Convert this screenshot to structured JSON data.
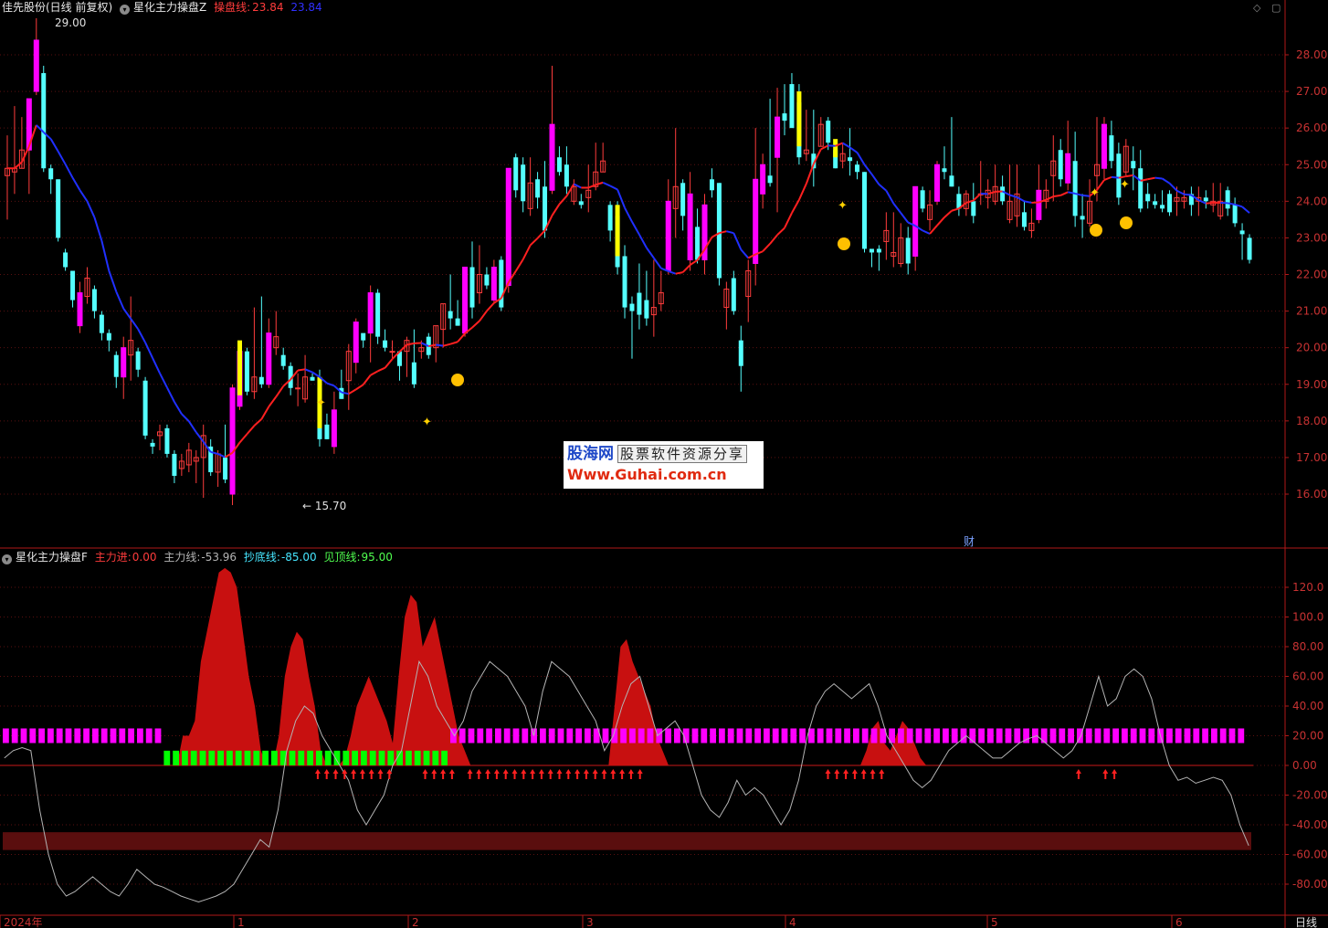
{
  "main_header": {
    "stock": "佳先股份(日线 前复权)",
    "indicator": "星化主力操盘Z",
    "line_label": "操盘线:",
    "line_value_1": "23.84",
    "line_value_2": "23.84"
  },
  "sub_header": {
    "indicator": "星化主力操盘F",
    "items": [
      {
        "label": "主力进:",
        "value": "0.00",
        "color": "#ff3c3c"
      },
      {
        "label": "主力线:",
        "value": "-53.96",
        "color": "#b4b4b4"
      },
      {
        "label": "抄底线:",
        "value": "-85.00",
        "color": "#46e6ff"
      },
      {
        "label": "见顶线:",
        "value": "95.00",
        "color": "#50ff50"
      }
    ]
  },
  "price_axis_labels": [
    "28.00",
    "27.00",
    "26.00",
    "25.00",
    "24.00",
    "23.00",
    "22.00",
    "21.00",
    "20.00",
    "19.00",
    "18.00",
    "17.00",
    "16.00"
  ],
  "osc_axis_labels": [
    "120.0",
    "100.0",
    "80.00",
    "60.00",
    "40.00",
    "20.00",
    "0.00",
    "-20.00",
    "-40.00",
    "-60.00",
    "-80.00"
  ],
  "date_labels": [
    "2024年",
    "1",
    "2",
    "3",
    "4",
    "5",
    "6"
  ],
  "period_label": "日线",
  "annotations": {
    "high": "29.00",
    "low": "15.70",
    "cai": "财"
  },
  "watermark": {
    "name": "股海网",
    "tag": "股票软件资源分享",
    "url": "Www.Guhai.com.cn"
  },
  "colors": {
    "up": "#ff3c3c",
    "down": "#54ffff",
    "up_fill": "#ff00ff",
    "highlight": "#ffff00",
    "line_up": "#ff2020",
    "line_down": "#2030ff",
    "area": "#c81010"
  },
  "chart_data": {
    "type": "candlestick",
    "price_range": [
      15.0,
      28.6
    ],
    "candles": [
      [
        24.7,
        24.9,
        23.5,
        25.8
      ],
      [
        24.8,
        24.9,
        24.2,
        26.6
      ],
      [
        24.9,
        25.4,
        24.9,
        26.3
      ],
      [
        25.4,
        26.8,
        24.2,
        26.8
      ],
      [
        27.0,
        28.4,
        26.9,
        29.0
      ],
      [
        27.5,
        24.9,
        24.8,
        27.7
      ],
      [
        24.9,
        24.6,
        24.2,
        25.0
      ],
      [
        24.6,
        23.0,
        22.9,
        24.6
      ],
      [
        22.6,
        22.2,
        22.1,
        22.7
      ],
      [
        22.1,
        21.3,
        21.1,
        22.1
      ],
      [
        20.6,
        21.5,
        20.4,
        21.8
      ],
      [
        21.4,
        21.9,
        21.2,
        22.2
      ],
      [
        21.6,
        21.0,
        20.8,
        21.7
      ],
      [
        20.9,
        20.4,
        20.2,
        21.0
      ],
      [
        20.4,
        20.2,
        19.9,
        20.5
      ],
      [
        19.8,
        19.2,
        18.9,
        19.9
      ],
      [
        19.2,
        20.0,
        18.6,
        20.3
      ],
      [
        19.8,
        20.2,
        19.1,
        21.4
      ],
      [
        19.9,
        19.4,
        19.2,
        20.0
      ],
      [
        19.1,
        17.6,
        17.5,
        19.2
      ],
      [
        17.4,
        17.3,
        17.1,
        17.5
      ],
      [
        17.6,
        17.7,
        17.2,
        17.9
      ],
      [
        17.8,
        17.1,
        17.0,
        17.9
      ],
      [
        17.1,
        16.5,
        16.3,
        17.2
      ],
      [
        16.7,
        16.9,
        16.5,
        17.1
      ],
      [
        16.8,
        17.2,
        16.6,
        17.4
      ],
      [
        16.9,
        17.0,
        16.3,
        17.2
      ],
      [
        17.0,
        17.6,
        15.9,
        17.9
      ],
      [
        17.3,
        16.6,
        16.5,
        17.5
      ],
      [
        16.6,
        17.1,
        16.2,
        17.2
      ],
      [
        17.0,
        16.4,
        16.3,
        17.9
      ],
      [
        16.0,
        18.9,
        15.7,
        19.0
      ],
      [
        18.4,
        19.9,
        18.3,
        20.0
      ],
      [
        19.9,
        18.8,
        18.7,
        20.0
      ],
      [
        18.8,
        19.2,
        18.6,
        21.1
      ],
      [
        19.2,
        19.0,
        18.9,
        21.4
      ],
      [
        19.0,
        20.4,
        18.9,
        20.8
      ],
      [
        20.0,
        20.3,
        19.8,
        21.0
      ],
      [
        19.8,
        19.5,
        19.4,
        20.0
      ],
      [
        19.5,
        18.9,
        18.7,
        19.6
      ],
      [
        18.9,
        18.9,
        18.4,
        19.3
      ],
      [
        18.6,
        19.2,
        18.5,
        19.8
      ],
      [
        19.2,
        19.1,
        19.1,
        19.3
      ],
      [
        18.9,
        17.5,
        17.3,
        19.4
      ],
      [
        17.9,
        17.5,
        17.5,
        18.2
      ],
      [
        17.3,
        18.3,
        17.1,
        18.8
      ],
      [
        18.9,
        18.6,
        18.6,
        19.4
      ],
      [
        19.1,
        19.9,
        18.3,
        20.1
      ],
      [
        19.6,
        20.7,
        19.3,
        20.8
      ],
      [
        20.4,
        20.2,
        20.0,
        20.3
      ],
      [
        20.4,
        21.5,
        19.6,
        21.7
      ],
      [
        21.5,
        20.3,
        20.1,
        21.6
      ],
      [
        20.2,
        20.0,
        19.9,
        20.5
      ],
      [
        19.9,
        19.9,
        19.7,
        20.2
      ],
      [
        19.9,
        19.5,
        19.1,
        19.9
      ],
      [
        19.9,
        20.2,
        19.2,
        20.3
      ],
      [
        19.6,
        19.0,
        18.9,
        20.5
      ],
      [
        19.9,
        20.0,
        19.7,
        20.2
      ],
      [
        20.3,
        19.8,
        19.7,
        20.4
      ],
      [
        20.0,
        20.6,
        19.6,
        20.6
      ],
      [
        20.5,
        21.2,
        20.0,
        21.2
      ],
      [
        21.0,
        20.8,
        20.5,
        22.0
      ],
      [
        20.8,
        20.6,
        20.6,
        21.3
      ],
      [
        20.4,
        22.2,
        20.3,
        22.2
      ],
      [
        22.2,
        21.1,
        20.8,
        22.9
      ],
      [
        21.5,
        22.0,
        21.2,
        22.8
      ],
      [
        22.0,
        21.7,
        21.6,
        22.2
      ],
      [
        21.3,
        22.2,
        21.2,
        22.4
      ],
      [
        22.4,
        21.1,
        21.0,
        22.5
      ],
      [
        21.7,
        24.9,
        21.5,
        24.9
      ],
      [
        25.2,
        24.3,
        24.1,
        25.3
      ],
      [
        25.0,
        24.0,
        23.7,
        25.2
      ],
      [
        23.8,
        24.5,
        23.6,
        25.2
      ],
      [
        24.6,
        24.1,
        23.8,
        24.8
      ],
      [
        24.4,
        23.2,
        23.0,
        25.1
      ],
      [
        24.3,
        26.1,
        24.2,
        27.7
      ],
      [
        25.2,
        24.8,
        24.7,
        25.5
      ],
      [
        25.0,
        24.4,
        24.2,
        25.5
      ],
      [
        24.0,
        24.4,
        23.9,
        24.6
      ],
      [
        24.0,
        23.9,
        23.8,
        24.2
      ],
      [
        24.1,
        24.3,
        23.7,
        25.0
      ],
      [
        24.4,
        24.8,
        24.3,
        25.6
      ],
      [
        24.8,
        25.1,
        24.8,
        25.6
      ],
      [
        23.9,
        23.2,
        22.9,
        24.0
      ],
      [
        23.6,
        22.2,
        22.0,
        24.0
      ],
      [
        22.5,
        21.1,
        20.8,
        22.8
      ],
      [
        21.2,
        21.0,
        19.7,
        21.4
      ],
      [
        21.5,
        20.9,
        20.5,
        22.3
      ],
      [
        21.3,
        20.8,
        20.6,
        22.1
      ],
      [
        20.9,
        21.1,
        20.3,
        22.4
      ],
      [
        21.2,
        21.5,
        21.0,
        22.1
      ],
      [
        22.1,
        24.0,
        22.0,
        24.6
      ],
      [
        23.8,
        24.4,
        23.0,
        26.0
      ],
      [
        24.5,
        23.6,
        23.2,
        24.6
      ],
      [
        22.4,
        24.2,
        22.1,
        24.8
      ],
      [
        23.3,
        22.4,
        22.3,
        23.8
      ],
      [
        22.4,
        23.9,
        22.0,
        24.2
      ],
      [
        24.6,
        24.3,
        24.1,
        24.9
      ],
      [
        24.5,
        21.9,
        21.7,
        24.5
      ],
      [
        21.1,
        21.6,
        20.5,
        21.8
      ],
      [
        21.9,
        21.0,
        20.9,
        22.1
      ],
      [
        20.2,
        19.5,
        18.8,
        20.6
      ],
      [
        21.4,
        22.1,
        20.7,
        22.4
      ],
      [
        22.3,
        24.6,
        21.7,
        26.0
      ],
      [
        24.2,
        25.0,
        23.8,
        25.3
      ],
      [
        24.7,
        24.5,
        24.4,
        26.8
      ],
      [
        25.2,
        26.3,
        23.7,
        27.1
      ],
      [
        26.4,
        26.2,
        25.8,
        27.2
      ],
      [
        27.2,
        26.0,
        26.1,
        27.5
      ],
      [
        26.7,
        25.2,
        25.0,
        27.2
      ],
      [
        25.3,
        25.4,
        25.1,
        26.5
      ],
      [
        25.3,
        24.9,
        24.4,
        26.5
      ],
      [
        25.5,
        26.1,
        25.5,
        26.3
      ],
      [
        26.2,
        25.6,
        25.4,
        26.3
      ],
      [
        25.4,
        24.9,
        24.9,
        25.4
      ],
      [
        25.1,
        25.3,
        24.9,
        25.6
      ],
      [
        25.2,
        25.1,
        24.7,
        26.0
      ],
      [
        25.0,
        24.8,
        24.6,
        25.1
      ],
      [
        24.8,
        22.7,
        22.6,
        24.8
      ],
      [
        22.7,
        22.6,
        22.2,
        22.6
      ],
      [
        22.7,
        22.6,
        22.1,
        22.8
      ],
      [
        22.9,
        23.2,
        22.4,
        23.7
      ],
      [
        22.5,
        22.6,
        22.2,
        23.7
      ],
      [
        22.3,
        23.0,
        22.2,
        23.4
      ],
      [
        23.0,
        22.3,
        22.0,
        23.3
      ],
      [
        22.5,
        24.4,
        22.1,
        24.4
      ],
      [
        24.3,
        23.8,
        23.7,
        24.4
      ],
      [
        23.5,
        23.9,
        23.2,
        24.3
      ],
      [
        24.0,
        25.0,
        23.9,
        25.1
      ],
      [
        24.9,
        24.8,
        24.6,
        25.5
      ],
      [
        24.7,
        24.4,
        24.4,
        26.3
      ],
      [
        24.2,
        23.8,
        23.6,
        24.4
      ],
      [
        23.8,
        24.2,
        23.6,
        24.3
      ],
      [
        24.0,
        23.6,
        23.4,
        24.5
      ],
      [
        24.2,
        24.2,
        23.9,
        25.1
      ],
      [
        24.1,
        24.3,
        23.8,
        24.6
      ],
      [
        24.0,
        24.4,
        23.9,
        25.0
      ],
      [
        24.4,
        24.0,
        23.9,
        24.7
      ],
      [
        23.5,
        24.0,
        23.4,
        25.0
      ],
      [
        23.6,
        24.2,
        23.3,
        25.0
      ],
      [
        23.7,
        23.3,
        23.2,
        24.0
      ],
      [
        23.2,
        23.4,
        23.0,
        23.8
      ],
      [
        23.5,
        24.3,
        23.4,
        25.0
      ],
      [
        24.0,
        24.3,
        23.8,
        24.6
      ],
      [
        24.7,
        25.1,
        24.0,
        25.8
      ],
      [
        25.4,
        24.6,
        24.4,
        25.7
      ],
      [
        24.5,
        25.3,
        24.3,
        26.2
      ],
      [
        25.1,
        23.6,
        23.3,
        25.9
      ],
      [
        23.6,
        23.5,
        23.0,
        24.2
      ],
      [
        23.4,
        24.0,
        23.3,
        24.6
      ],
      [
        24.7,
        25.0,
        24.0,
        26.3
      ],
      [
        24.9,
        26.1,
        24.6,
        26.3
      ],
      [
        25.8,
        25.1,
        24.9,
        26.2
      ],
      [
        25.3,
        24.1,
        23.9,
        25.6
      ],
      [
        24.8,
        25.5,
        24.7,
        25.7
      ],
      [
        25.1,
        24.9,
        24.3,
        25.5
      ],
      [
        24.9,
        23.8,
        23.7,
        25.4
      ],
      [
        24.2,
        24.0,
        23.8,
        24.5
      ],
      [
        24.0,
        23.9,
        23.8,
        24.2
      ],
      [
        23.9,
        23.8,
        23.7,
        24.3
      ],
      [
        24.2,
        23.7,
        23.6,
        24.3
      ],
      [
        24.0,
        24.1,
        23.6,
        24.4
      ],
      [
        24.0,
        24.1,
        23.8,
        24.3
      ],
      [
        24.2,
        23.9,
        23.6,
        24.4
      ],
      [
        24.0,
        24.1,
        23.6,
        24.4
      ],
      [
        24.1,
        24.0,
        23.8,
        24.3
      ],
      [
        23.9,
        24.0,
        23.7,
        24.5
      ],
      [
        23.6,
        24.0,
        23.5,
        24.5
      ],
      [
        24.3,
        23.8,
        23.6,
        24.4
      ],
      [
        23.9,
        23.4,
        23.3,
        24.1
      ],
      [
        23.2,
        23.1,
        22.4,
        23.4
      ],
      [
        23.0,
        22.4,
        22.3,
        23.1
      ]
    ],
    "osc_range": [
      -90,
      135
    ],
    "area": [
      0,
      0,
      0,
      0,
      0,
      0,
      0,
      0,
      0,
      0,
      0,
      0,
      0,
      0,
      0,
      0,
      0,
      0,
      0,
      0,
      0,
      0,
      0,
      0,
      0,
      0,
      0,
      0,
      0,
      0,
      20,
      20,
      30,
      70,
      90,
      110,
      130,
      133,
      130,
      120,
      90,
      60,
      40,
      10,
      0,
      0,
      20,
      60,
      80,
      90,
      85,
      60,
      40,
      10,
      0,
      0,
      0,
      5,
      20,
      40,
      50,
      60,
      50,
      40,
      30,
      15,
      60,
      100,
      115,
      110,
      80,
      90,
      100,
      80,
      60,
      40,
      20,
      10,
      0,
      0,
      0,
      0,
      0,
      0,
      0,
      0,
      0,
      0,
      0,
      0,
      0,
      0,
      0,
      0,
      0,
      0,
      0,
      0,
      0,
      0,
      0,
      0,
      40,
      80,
      85,
      70,
      60,
      50,
      40,
      20,
      10,
      0,
      0,
      0,
      0,
      0,
      0,
      0,
      0,
      0,
      0,
      0,
      0,
      0,
      0,
      0,
      0,
      0,
      0,
      0,
      0,
      0,
      0,
      0,
      0,
      0,
      0,
      0,
      0,
      0,
      0,
      0,
      0,
      0,
      10,
      25,
      30,
      15,
      10,
      20,
      30,
      25,
      15,
      5,
      0,
      0,
      0,
      0,
      0,
      0,
      0,
      0,
      0,
      0,
      0,
      0,
      0,
      0,
      0,
      0,
      0,
      0,
      0,
      0,
      0,
      0,
      0,
      0,
      0,
      0,
      0,
      0,
      0,
      0,
      0,
      0,
      0,
      0,
      0,
      0,
      0,
      0,
      0,
      0,
      0,
      0,
      0,
      0,
      0,
      0,
      0,
      0,
      0,
      0,
      0,
      0,
      0,
      0,
      0
    ],
    "line": [
      5,
      10,
      12,
      10,
      -30,
      -60,
      -80,
      -88,
      -85,
      -80,
      -75,
      -80,
      -85,
      -88,
      -80,
      -70,
      -75,
      -80,
      -82,
      -85,
      -88,
      -90,
      -92,
      -90,
      -88,
      -85,
      -80,
      -70,
      -60,
      -50,
      -55,
      -30,
      10,
      30,
      40,
      35,
      20,
      10,
      0,
      -10,
      -30,
      -40,
      -30,
      -20,
      0,
      10,
      40,
      70,
      60,
      40,
      30,
      20,
      30,
      50,
      60,
      70,
      65,
      60,
      50,
      40,
      20,
      50,
      70,
      65,
      60,
      50,
      40,
      30,
      10,
      20,
      40,
      55,
      60,
      40,
      20,
      25,
      30,
      20,
      0,
      -20,
      -30,
      -35,
      -25,
      -10,
      -20,
      -15,
      -20,
      -30,
      -40,
      -30,
      -10,
      20,
      40,
      50,
      55,
      50,
      45,
      50,
      55,
      40,
      20,
      10,
      0,
      -10,
      -15,
      -10,
      0,
      10,
      15,
      20,
      15,
      10,
      5,
      5,
      10,
      15,
      18,
      20,
      15,
      10,
      5,
      10,
      20,
      40,
      60,
      40,
      45,
      60,
      65,
      60,
      45,
      20,
      0,
      -10,
      -8,
      -12,
      -10,
      -8,
      -10,
      -20,
      -40,
      -54
    ],
    "bottom_band": [
      -45,
      -57
    ],
    "bar_zones": [
      {
        "from": 0,
        "to": 17,
        "value": 20,
        "color": "#ff00ff"
      },
      {
        "from": 18,
        "to": 49,
        "value": 5,
        "color": "#00ff00"
      },
      {
        "from": 50,
        "to": 138,
        "value": 20,
        "color": "#ff00ff"
      }
    ],
    "arrow_indices": [
      35,
      36,
      37,
      38,
      39,
      40,
      41,
      42,
      43,
      47,
      48,
      49,
      50,
      52,
      53,
      54,
      55,
      56,
      57,
      58,
      59,
      60,
      61,
      62,
      63,
      64,
      65,
      66,
      67,
      68,
      69,
      70,
      71,
      92,
      93,
      94,
      95,
      96,
      97,
      98,
      120,
      123,
      124
    ]
  }
}
